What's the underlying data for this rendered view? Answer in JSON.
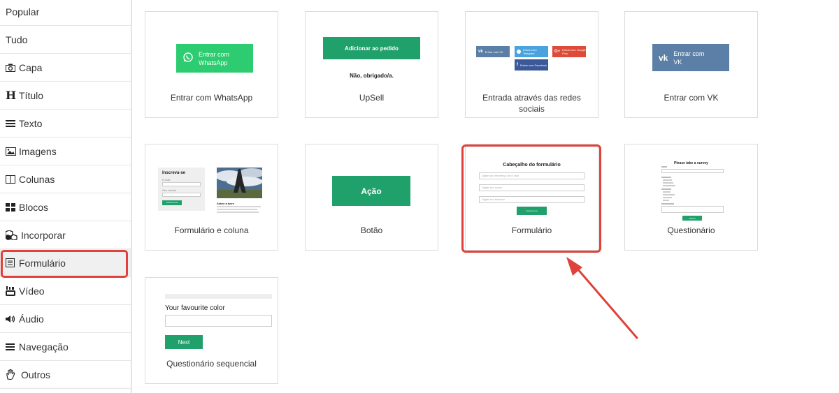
{
  "sidebar": {
    "items": [
      {
        "label": "Popular",
        "icon": ""
      },
      {
        "label": "Tudo",
        "icon": ""
      },
      {
        "label": "Capa",
        "icon": "camera-icon"
      },
      {
        "label": "Título",
        "icon": "heading-icon"
      },
      {
        "label": "Texto",
        "icon": "text-lines-icon"
      },
      {
        "label": "Imagens",
        "icon": "image-icon"
      },
      {
        "label": "Colunas",
        "icon": "columns-icon"
      },
      {
        "label": "Blocos",
        "icon": "blocks-icon"
      },
      {
        "label": "Incorporar",
        "icon": "embed-icon"
      },
      {
        "label": "Formulário",
        "icon": "form-icon"
      },
      {
        "label": "Vídeo",
        "icon": "youtube-icon"
      },
      {
        "label": "Áudio",
        "icon": "volume-icon"
      },
      {
        "label": "Navegação",
        "icon": "menu-icon"
      },
      {
        "label": "Outros",
        "icon": "hand-icon"
      }
    ],
    "active_index": 9,
    "highlight_color": "#e0413a"
  },
  "cards": {
    "whatsapp": {
      "label": "Entrar com WhatsApp",
      "preview_button": "Entrar com WhatsApp",
      "preview_line1": "Entrar com",
      "preview_line2": "WhatsApp",
      "color": "#2ecc71"
    },
    "upsell": {
      "label": "UpSell",
      "preview_button": "Adicionar ao pedido",
      "preview_decline": "Não, obrigado/a.",
      "color": "#20a06b"
    },
    "social": {
      "label": "Entrada através das redes sociais",
      "label_line1": "Entrada através das redes",
      "label_line2": "sociais",
      "vk": "Entrar com VK",
      "telegram": "Entrar com Telegram",
      "google": "Entrar com Google Plus",
      "facebook": "Entrar com Facebook"
    },
    "vk": {
      "label": "Entrar com VK",
      "preview_line1": "Entrar com",
      "preview_line2": "VK",
      "color": "#5b7fa6"
    },
    "form_column": {
      "label": "Formulário e coluna",
      "heading": "Inscreva-se",
      "field1_label": "E-mail",
      "field2_label": "Seu celular",
      "button": "Inscrever-se",
      "side_title": "Sobre a torre"
    },
    "button": {
      "label": "Botão",
      "preview_button": "Ação",
      "color": "#20a06b"
    },
    "form": {
      "label": "Formulário",
      "heading": "Cabeçalho do formulário",
      "field1": "Digite seu endereço de e-mail",
      "field2": "Digite seu nome",
      "field3": "Digite seu telefone",
      "button": "Inscrever-se"
    },
    "survey": {
      "label": "Questionário",
      "heading": "Please take a survey",
      "button": "Submit"
    },
    "sequential": {
      "label": "Questionário sequencial",
      "question": "Your favourite color",
      "button": "Next",
      "color": "#20a06b"
    }
  }
}
